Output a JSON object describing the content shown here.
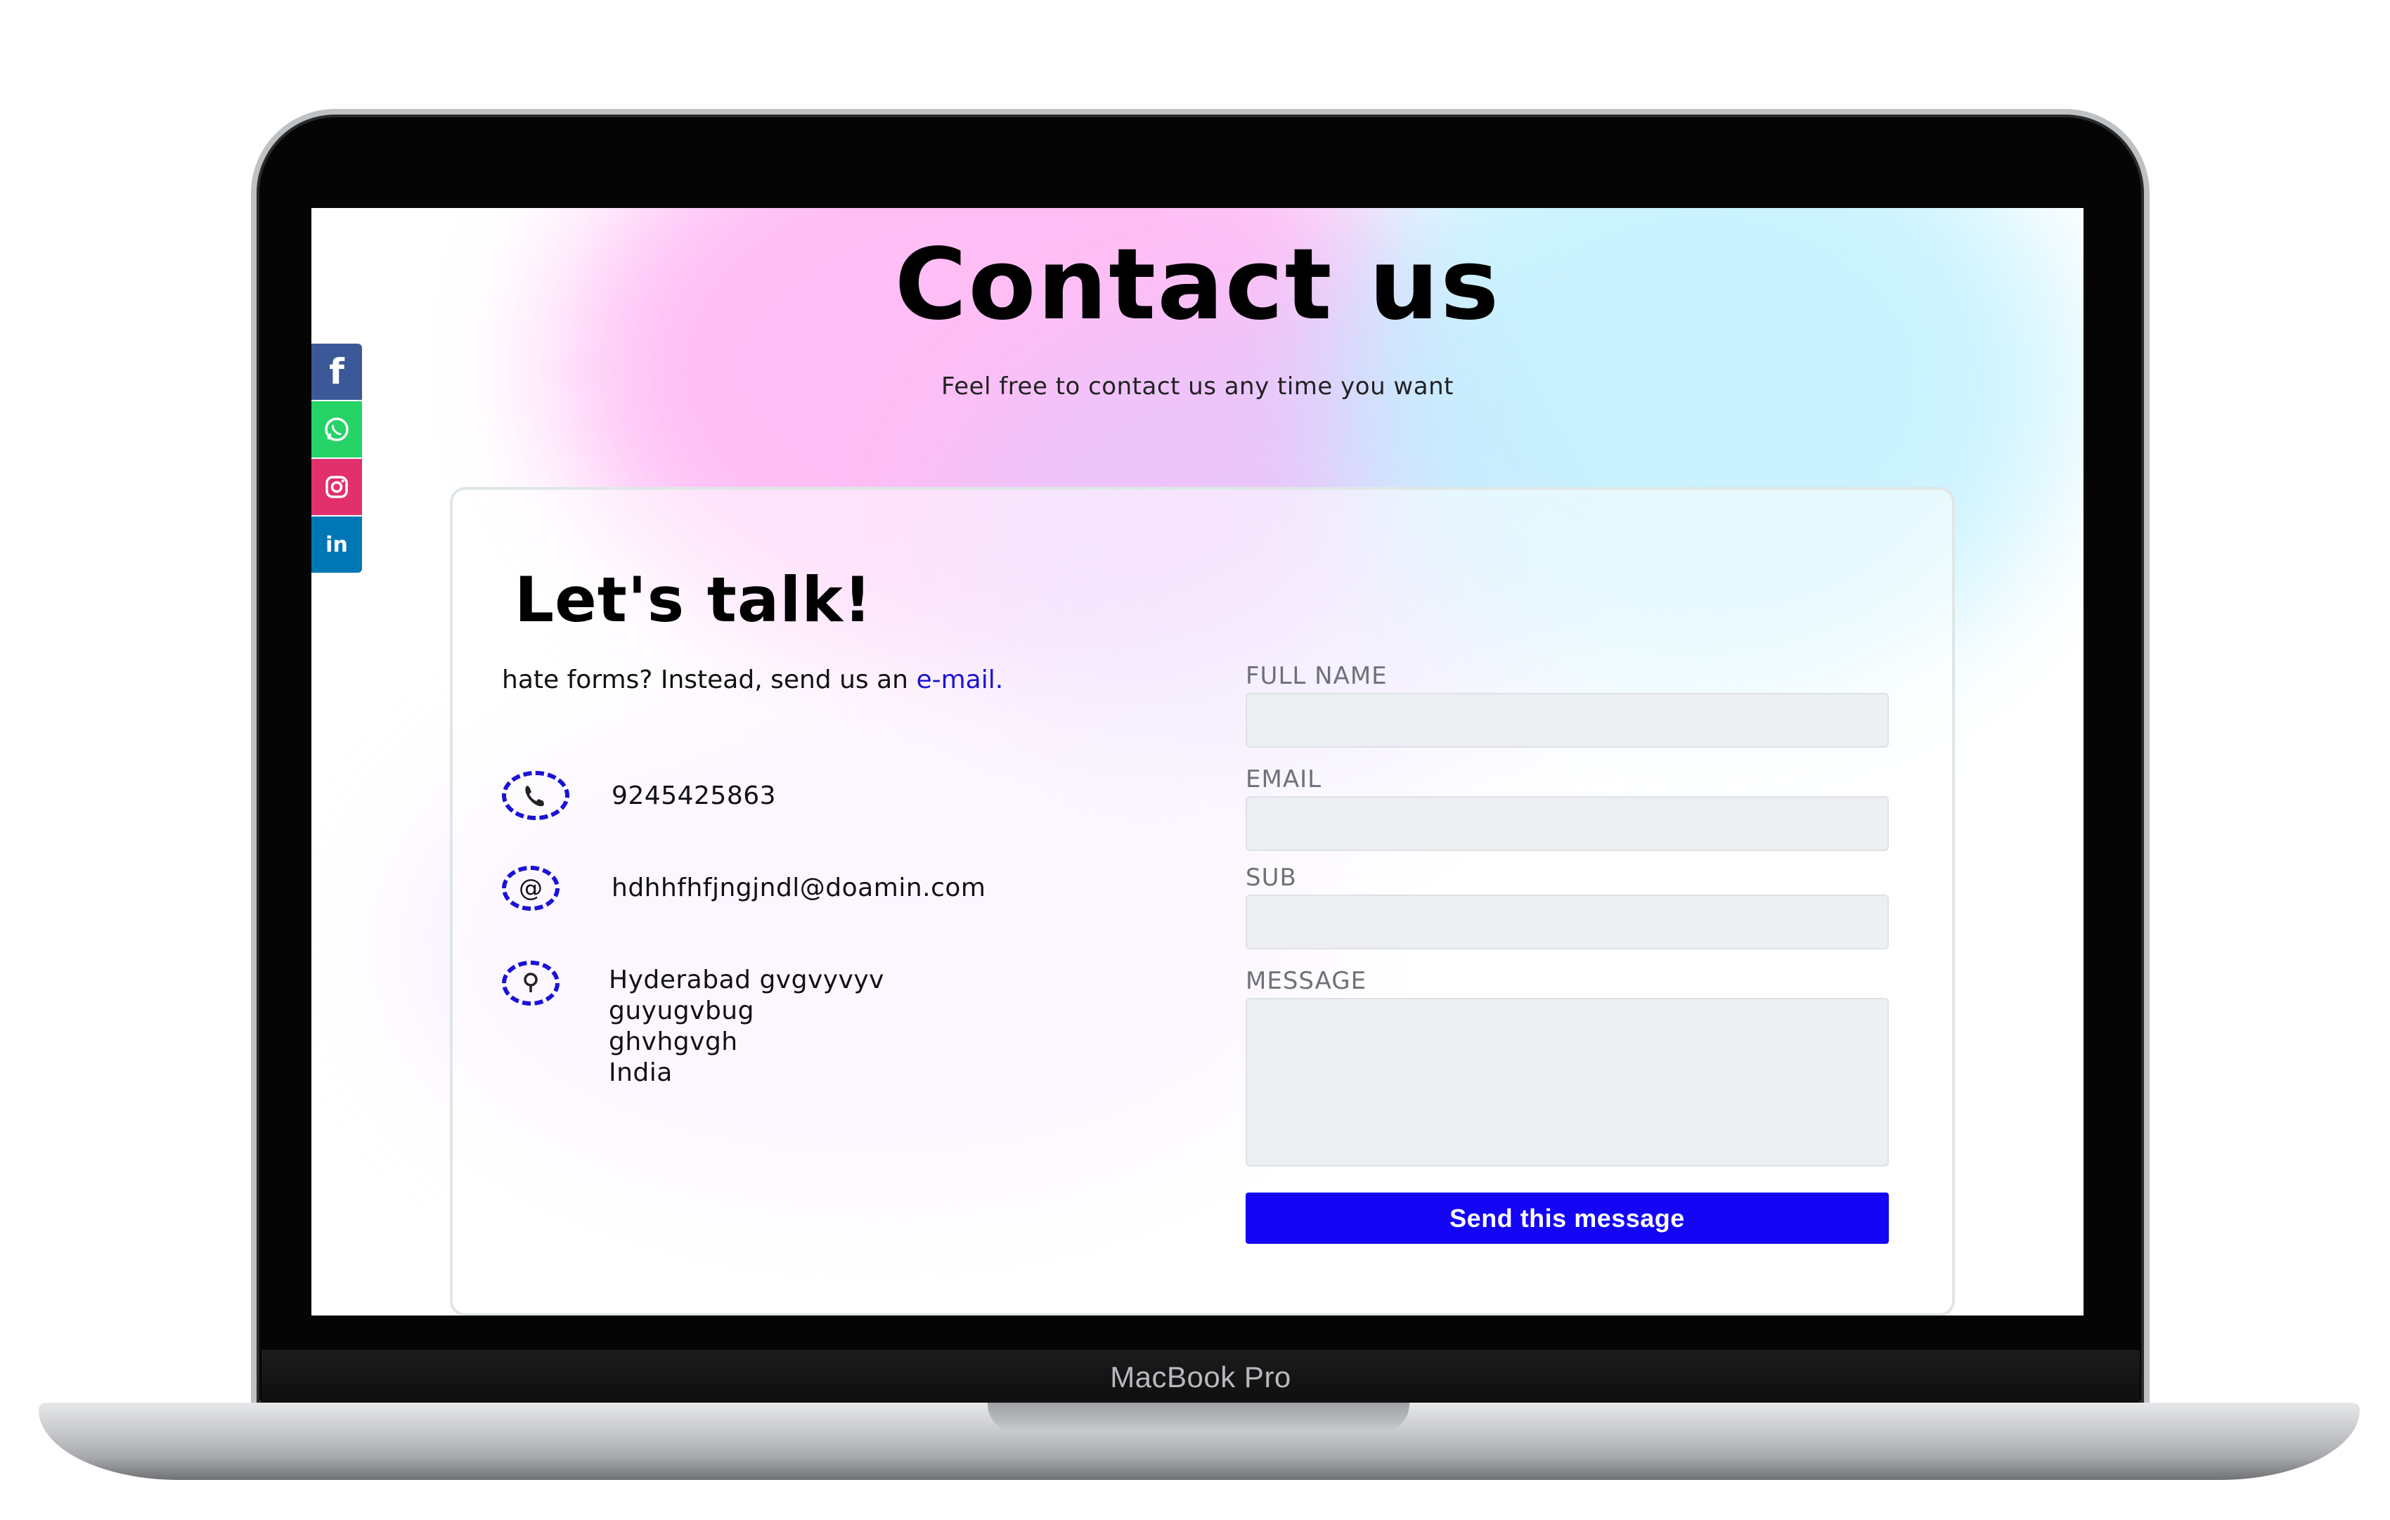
{
  "device": {
    "brand_label": "MacBook Pro"
  },
  "header": {
    "title": "Contact us",
    "subtitle": "Feel free to contact us any time you want"
  },
  "social": {
    "items": [
      {
        "label": "f",
        "icon": "facebook-icon",
        "color": "#3b5998"
      },
      {
        "label": "",
        "icon": "whatsapp-icon",
        "color": "#25d366"
      },
      {
        "label": "",
        "icon": "instagram-icon",
        "color": "#e1306c"
      },
      {
        "label": "in",
        "icon": "linkedin-icon",
        "color": "#0077b5"
      }
    ]
  },
  "card": {
    "heading": "Let's talk!",
    "lead_text": "hate forms? Instead, send us an ",
    "lead_link": "e-mail.",
    "phone": "9245425863",
    "email": "hdhhfhfjngjndl@doamin.com",
    "address": [
      "Hyderabad gvgvyvyv",
      "guyugvbug",
      "ghvhgvgh",
      "India"
    ],
    "icons": {
      "phone": "phone-icon",
      "email": "at-sign-icon",
      "address": "location-pin-icon"
    }
  },
  "form": {
    "full_name_label": "FULL NAME",
    "email_label": "EMAIL",
    "subject_label": "SUB",
    "message_label": "MESSAGE",
    "full_name_value": "",
    "email_value": "",
    "subject_value": "",
    "message_value": "",
    "submit_label": "Send this message"
  },
  "colors": {
    "accent": "#1405f5",
    "link": "#1a12d4",
    "input_bg": "#edeff2"
  }
}
